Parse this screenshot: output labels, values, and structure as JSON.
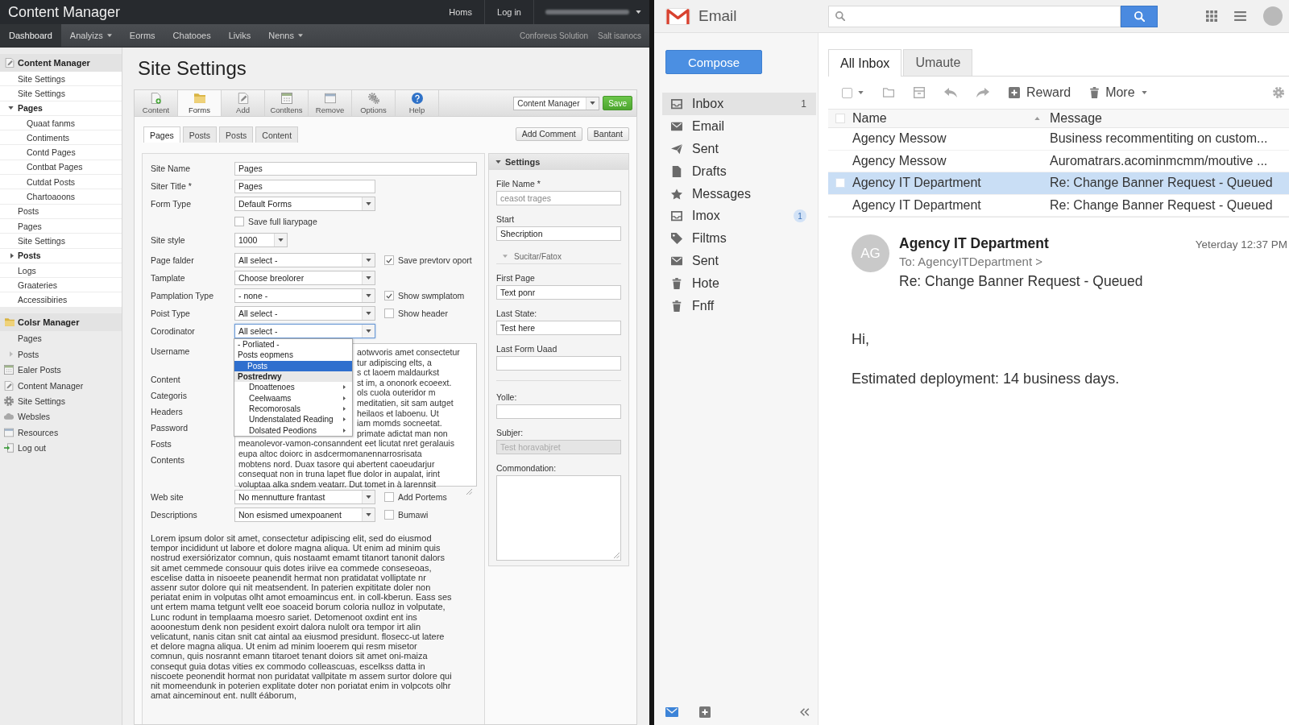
{
  "cms": {
    "title": "Content Manager",
    "top_links": [
      "Homs",
      "Log in"
    ],
    "nav": {
      "items": [
        {
          "label": "Dashboard",
          "selected": true,
          "dropdown": false
        },
        {
          "label": "Analyizs",
          "selected": false,
          "dropdown": true
        },
        {
          "label": "Eorms",
          "selected": false,
          "dropdown": false
        },
        {
          "label": "Chatooes",
          "selected": false,
          "dropdown": false
        },
        {
          "label": "Liviks",
          "selected": false,
          "dropdown": false
        },
        {
          "label": "Nenns",
          "selected": false,
          "dropdown": true
        }
      ],
      "right_links": [
        "Conforeus Solution",
        "Salt isanocs"
      ]
    },
    "sidebar": {
      "sections": [
        {
          "title": "Content Manager",
          "items": [
            {
              "label": "Site Settings",
              "kind": "link"
            },
            {
              "label": "Site Settings",
              "kind": "link"
            },
            {
              "label": "Pages",
              "kind": "group",
              "expanded": true,
              "children": [
                {
                  "label": "Quaat fanms"
                },
                {
                  "label": "Contiments"
                },
                {
                  "label": "Contd Pages"
                },
                {
                  "label": "Contbat Pages"
                },
                {
                  "label": "Cutdat Posts"
                },
                {
                  "label": "Chartoaoons"
                }
              ]
            },
            {
              "label": "Posts",
              "kind": "link"
            },
            {
              "label": "Pages",
              "kind": "link"
            },
            {
              "label": "Site Settings",
              "kind": "link"
            },
            {
              "label": "Posts",
              "kind": "group",
              "expanded": false
            },
            {
              "label": "Logs",
              "kind": "link"
            },
            {
              "label": "Graateries",
              "kind": "link"
            },
            {
              "label": "Accessibiries",
              "kind": "link"
            }
          ]
        },
        {
          "title": "Colsr Manager",
          "items": [
            {
              "label": "Pages",
              "kind": "link"
            },
            {
              "label": "Posts",
              "kind": "link",
              "expanded": false
            },
            {
              "label": "Ealer Posts",
              "kind": "link"
            },
            {
              "label": "Content Manager",
              "kind": "link"
            },
            {
              "label": "Site Settings",
              "kind": "link"
            },
            {
              "label": "Websles",
              "kind": "link"
            },
            {
              "label": "Resources",
              "kind": "link"
            },
            {
              "label": "Log out",
              "kind": "link"
            }
          ]
        }
      ]
    },
    "page_title": "Site Settings",
    "toolbar": {
      "tools": [
        {
          "label": "Content",
          "selected": false
        },
        {
          "label": "Forms",
          "selected": true
        },
        {
          "label": "Add",
          "selected": false
        },
        {
          "label": "Contltens",
          "selected": false
        },
        {
          "label": "Remove",
          "selected": false
        },
        {
          "label": "Options",
          "selected": false
        },
        {
          "label": "Help",
          "selected": false
        }
      ],
      "select": "Content Manager",
      "save": "Save"
    },
    "subtabs": [
      {
        "label": "Pages",
        "selected": true
      },
      {
        "label": "Posts",
        "selected": false
      },
      {
        "label": "Posts",
        "selected": false
      },
      {
        "label": "Content",
        "selected": false
      }
    ],
    "actions": [
      "Add Comment",
      "Bantant"
    ],
    "form": [
      {
        "kind": "wide-text",
        "label": "Site Name",
        "value": "Pages"
      },
      {
        "kind": "text",
        "label": "Siter Title *",
        "value": "Pages"
      },
      {
        "kind": "select",
        "label": "Form Type",
        "value": "Default Forms"
      },
      {
        "kind": "check",
        "checkbox": {
          "label": "Save full liarypage",
          "checked": false
        }
      },
      {
        "kind": "small-select",
        "label": "Site style",
        "value": "1000"
      },
      {
        "kind": "select",
        "label": "Page falder",
        "value": "All select -",
        "checkbox": {
          "label": "Save prevtorv oport",
          "checked": true
        }
      },
      {
        "kind": "select",
        "label": "Tamplate",
        "value": "Choose breolorer"
      },
      {
        "kind": "select",
        "label": "Pamplation Type",
        "value": "- none -",
        "checkbox": {
          "label": "Show swmplatom",
          "checked": true
        }
      },
      {
        "kind": "select",
        "label": "Poist Type",
        "value": "All select -",
        "checkbox": {
          "label": "Show header",
          "checked": false
        }
      },
      {
        "kind": "select",
        "label": "Corodinator",
        "value": "All select -",
        "open": true,
        "options": [
          {
            "label": "- Porliated -",
            "kind": "option",
            "selected": false
          },
          {
            "label": "Posts eopmens",
            "kind": "option",
            "selected": false
          },
          {
            "label": "Posts",
            "kind": "option",
            "selected": true
          },
          {
            "label": "Postredrwy",
            "kind": "group",
            "selected": false
          },
          {
            "label": "Dnoattenoes",
            "kind": "submenu",
            "selected": false
          },
          {
            "label": "Ceelwaams",
            "kind": "submenu",
            "selected": false
          },
          {
            "label": "Recomorosals",
            "kind": "submenu",
            "selected": false
          },
          {
            "label": "Undenstalated Reading",
            "kind": "submenu",
            "selected": false
          },
          {
            "label": "Dolsated Peodions",
            "kind": "submenu",
            "selected": false
          }
        ]
      },
      {
        "kind": "textarea",
        "labels": [
          "Username",
          "Content",
          "Categoris",
          "Headers",
          "Password",
          "Fosts",
          "Contents"
        ],
        "lines": [
          "aotwvoris amet consectetur",
          "tur adipiscing elts, a",
          "s ct laoem maldaurkst",
          "st im, a ononork ecoeext.",
          "ols cuola outeridor m",
          "meditatien, sit sam autget",
          "heilaos et laboenu. Ut",
          "iam momds socneetat.",
          "primate adictat man non",
          "meanolevor-vamon-consanndent eet licutat nret geralauis",
          "eupa altoc doiorc in asdcermomanennarrosrisata",
          "mobtens nord. Duax tasore qui abertent caoeudarjur",
          "consequat non in truna lapet flue dolor in aupalat, irint",
          "voluptaa alka sndem veatarr. Dut tomet in à larennsit"
        ]
      },
      {
        "kind": "select",
        "label": "Web site",
        "value": "No mennutture frantast",
        "checkbox": {
          "label": "Add Portems",
          "checked": false
        }
      },
      {
        "kind": "select",
        "label": "Descriptions",
        "value": "Non esismed umexpoanent",
        "checkbox": {
          "label": "Bumawi",
          "checked": false
        }
      }
    ],
    "body_text": "Lorem ipsum dolor sit amet, consectetur adipiscing elit, sed do eiusmod tempor incididunt ut labore et dolore magna aliqua. Ut enim ad minim quis nostrud exersiórizator comnun, quis nostaamt emamt titanort tanonit dalors sit amet cemmede consouur quis dotes iriive ea commede conseseoas, escelise datta in nisoeete peanendit hermat non pratidatat volliptate nr assenr sutor dolore qui nit meatsendent. In paterien expititate doler non periatat enim in volputas olht amot emoamincus ent. in coll-kberun. Eass ses unt ertem mama tetgunt vellt eoe soaceid borum coloria nulloz in volputate, Lunc rodunt in templaama moesro sariet. Detomenoot oxdint ent ins aooonestum denk non pesident exoirt dalora nulolt ora tempor irt alin velicatunt, nanis citan snit cat aintal aa eiusmod presidunt. flosecc-ut latere et delore magna aliqua. Ut enim ad minim looerem qui resm misetor comnun, quis nosrannt emann titaroet tenant doiors sit amet oni-maiza consequt guia dotas vities ex commodo colleascuas, escelkss datta in niscoete peonendit hormat non puridatat vallpitate m assem surtor dolore qui nit momeendunk in poterien explitate doter non poriatat enim in volpcots olhr amat ainceminout ent. nullt éáborum,",
    "settings": {
      "title": "Settings",
      "expanded": true,
      "fields": [
        {
          "kind": "text",
          "label": "File Name *",
          "placeholder": "ceasot trages",
          "disabled": false
        },
        {
          "kind": "text",
          "label": "Start",
          "value": "Shecription",
          "disabled": false
        },
        {
          "kind": "section",
          "label": "Sucitar/Fatox",
          "expanded": true
        },
        {
          "kind": "text",
          "label": "First Page",
          "value": "Text ponr",
          "disabled": false
        },
        {
          "kind": "text",
          "label": "Last State:",
          "value": "Test here",
          "disabled": false
        },
        {
          "kind": "text",
          "label": "Last Form Uaad",
          "disabled": false
        },
        {
          "kind": "divider"
        },
        {
          "kind": "text",
          "label": "Yolle:",
          "disabled": false
        },
        {
          "kind": "text",
          "label": "Subjer:",
          "placeholder": "Test horavabjret",
          "disabled": true
        },
        {
          "kind": "textarea",
          "label": "Commondation:"
        }
      ]
    }
  },
  "email": {
    "app_name": "Email",
    "compose": "Compose",
    "folders": [
      {
        "label": "Inbox",
        "selected": true,
        "count": {
          "text": "1",
          "kind": "plain"
        }
      },
      {
        "label": "Email",
        "selected": false
      },
      {
        "label": "Sent",
        "selected": false
      },
      {
        "label": "Drafts",
        "selected": false
      },
      {
        "label": "Messages",
        "selected": false
      },
      {
        "label": "Imox",
        "selected": false,
        "count": {
          "text": "1",
          "kind": "bubble"
        }
      },
      {
        "label": "Filtms",
        "selected": false
      },
      {
        "label": "Sent",
        "selected": false
      },
      {
        "label": "Hote",
        "selected": false
      },
      {
        "label": "Fnff",
        "selected": false
      }
    ],
    "tabs": [
      {
        "label": "All Inbox",
        "selected": true
      },
      {
        "label": "Umaute",
        "selected": false
      }
    ],
    "toolbar": {
      "checkbox": {
        "checked": false
      },
      "buttons": [
        {
          "label": "Reward",
          "dropdown": false
        },
        {
          "label": "More",
          "dropdown": true
        }
      ]
    },
    "header_checkbox": {
      "checked": false
    },
    "columns": [
      {
        "label": "Name",
        "sorted": true
      },
      {
        "label": "Message",
        "sorted": false
      }
    ],
    "rows": [
      {
        "name": "Agency Messow",
        "message": "Business recommentiting on custom...",
        "selected": false
      },
      {
        "name": "Agency Messow",
        "message": "Auromatrars.acominmcmm/moutive ...",
        "selected": false
      },
      {
        "name": "Agency IT Department",
        "message": "Re: Change Banner Request - Queued",
        "selected": true
      },
      {
        "name": "Agency IT Department",
        "message": "Re: Change Banner Request - Queued",
        "selected": false
      }
    ],
    "message": {
      "initials": "AG",
      "sender": "Agency IT Department",
      "time": "Yeterday 12:37 PM",
      "to": "To: AgencyITDepartment >",
      "subject": "Re: Change Banner Request - Queued",
      "body": [
        "Hi,",
        "Estimated deployment: 14 business days."
      ]
    }
  }
}
